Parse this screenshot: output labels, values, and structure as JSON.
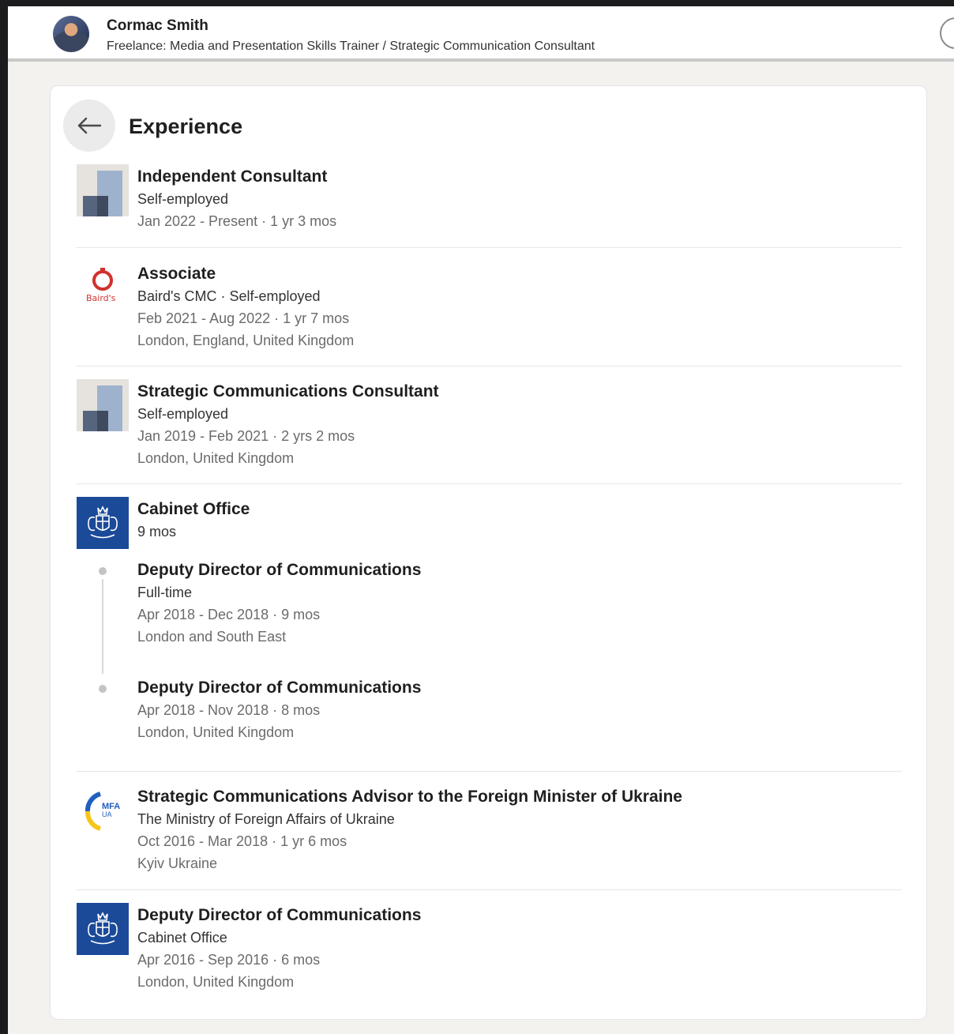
{
  "header": {
    "name": "Cormac Smith",
    "headline": "Freelance: Media and Presentation Skills Trainer / Strategic Communication Consultant"
  },
  "section": {
    "title": "Experience",
    "back_icon": "arrow-left-icon"
  },
  "experience": [
    {
      "title": "Independent Consultant",
      "company": "Self-employed",
      "dates": "Jan 2022 - Present · 1 yr 3 mos",
      "logo": "placeholder-company-logo"
    },
    {
      "title": "Associate",
      "company": "Baird's CMC · Self-employed",
      "dates": "Feb 2021 - Aug 2022 · 1 yr 7 mos",
      "location": "London, England, United Kingdom",
      "logo": "bairds-logo",
      "logo_text": "Baird's"
    },
    {
      "title": "Strategic Communications Consultant",
      "company": "Self-employed",
      "dates": "Jan 2019 - Feb 2021 · 2 yrs 2 mos",
      "location": "London, United Kingdom",
      "logo": "placeholder-company-logo"
    },
    {
      "company": "Cabinet Office",
      "duration": "9 mos",
      "logo": "royal-crest-logo",
      "roles": [
        {
          "title": "Deputy Director of Communications",
          "type": "Full-time",
          "dates": "Apr 2018 - Dec 2018 · 9 mos",
          "location": "London and South East"
        },
        {
          "title": "Deputy Director of Communications",
          "dates": "Apr 2018 - Nov 2018 · 8 mos",
          "location": "London, United Kingdom"
        }
      ]
    },
    {
      "title": "Strategic Communications Advisor to the Foreign Minister of Ukraine",
      "company": "The Ministry of Foreign Affairs of Ukraine",
      "dates": "Oct 2016 - Mar 2018 · 1 yr 6 mos",
      "location": "Kyiv Ukraine",
      "logo": "mfa-ukraine-logo",
      "logo_text": "MFA",
      "logo_subtext": "UA"
    },
    {
      "title": "Deputy Director of Communications",
      "company": "Cabinet Office",
      "dates": "Apr 2016 - Sep 2016 · 6 mos",
      "location": "London, United Kingdom",
      "logo": "royal-crest-logo"
    }
  ],
  "colors": {
    "background": "#f3f2ef",
    "card": "#ffffff",
    "cabinet_blue": "#1b4a99",
    "bairds_red": "#d0312d",
    "ukraine_blue": "#1f5fbf",
    "ukraine_yellow": "#f5c518"
  }
}
